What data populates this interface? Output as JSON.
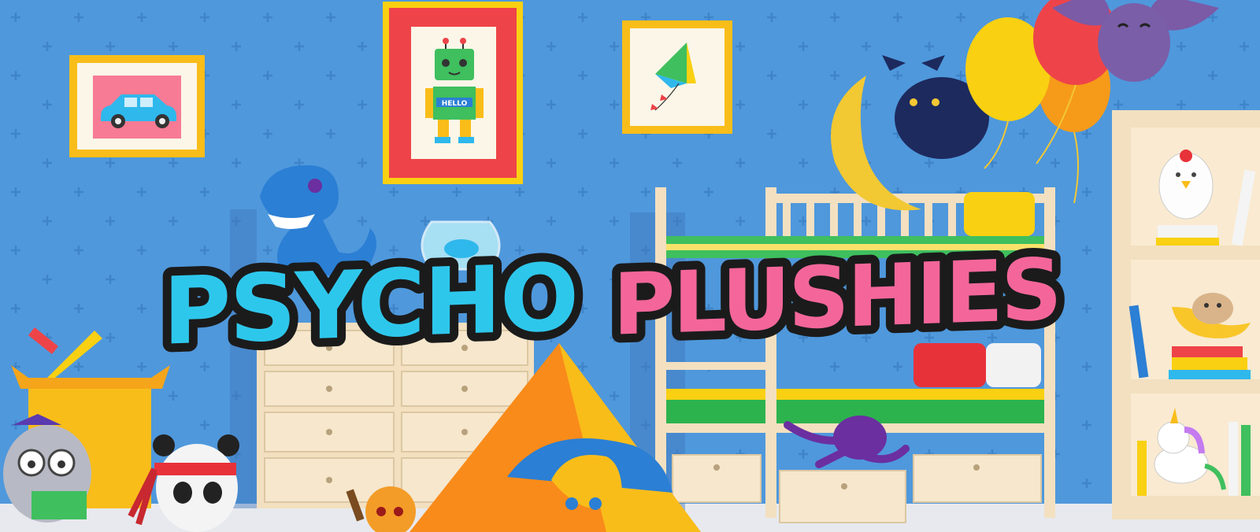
{
  "game": {
    "title_part1": "PSYCHO",
    "title_part2": "PLUSHIES",
    "robot_sign": "HELLO"
  },
  "colors": {
    "wall": "#4f98dc",
    "title_blue": "#2ec7ec",
    "title_pink": "#f4669a",
    "frame_yellow": "#f9bd1a",
    "frame_red": "#ee4449"
  },
  "icons": {
    "wall_pattern": "plus-icon",
    "car_picture": "car-icon",
    "robot_picture": "robot-icon",
    "kite_picture": "kite-icon"
  }
}
